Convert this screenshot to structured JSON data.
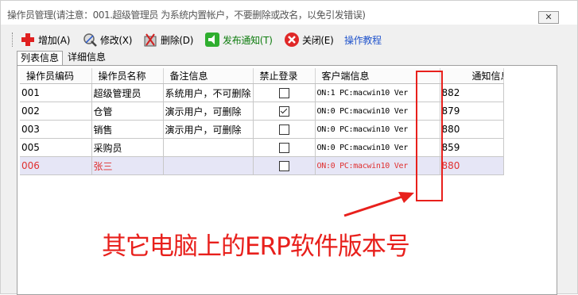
{
  "window": {
    "title": "操作员管理(请注意：001.超级管理员 为系统内置帐户，不要删除或改名，以免引发错误)",
    "close_glyph": "✕"
  },
  "toolbar": {
    "add": {
      "label": "增加(A)",
      "icon": "add-icon"
    },
    "edit": {
      "label": "修改(X)",
      "icon": "edit-icon"
    },
    "delete": {
      "label": "删除(D)",
      "icon": "delete-icon"
    },
    "publish": {
      "label": "发布通知(T)",
      "icon": "publish-icon"
    },
    "close": {
      "label": "关闭(E)",
      "icon": "close-icon"
    },
    "tutorial": {
      "label": "操作教程"
    }
  },
  "tabs": [
    "列表信息",
    "详细信息"
  ],
  "table": {
    "columns": [
      "操作员编码",
      "操作员名称",
      "备注信息",
      "禁止登录",
      "客户端信息",
      "通知信息"
    ],
    "rows": [
      {
        "code": "001",
        "name": "超级管理员",
        "note": "系统用户，不可删除",
        "disabled": false,
        "client": "ON:1 PC:macwin10 Ver",
        "version": "882",
        "selected": false
      },
      {
        "code": "002",
        "name": "仓管",
        "note": "演示用户，可删除",
        "disabled": true,
        "client": "ON:0 PC:macwin10 Ver",
        "version": "879",
        "selected": false
      },
      {
        "code": "003",
        "name": "销售",
        "note": "演示用户，可删除",
        "disabled": false,
        "client": "ON:0 PC:macwin10 Ver",
        "version": "880",
        "selected": false
      },
      {
        "code": "005",
        "name": "采购员",
        "note": "",
        "disabled": false,
        "client": "ON:0 PC:macwin10 Ver",
        "version": "859",
        "selected": false
      },
      {
        "code": "006",
        "name": "张三",
        "note": "",
        "disabled": false,
        "client": "ON:0 PC:macwin10 Ver",
        "version": "880",
        "selected": true
      }
    ]
  },
  "annotation": {
    "text": "其它电脑上的ERP软件版本号",
    "color": "#e8201c"
  },
  "colors": {
    "accent_link": "#2255cc",
    "selected_row_text": "#e03030",
    "selected_row_bg": "#e6e6f6"
  }
}
